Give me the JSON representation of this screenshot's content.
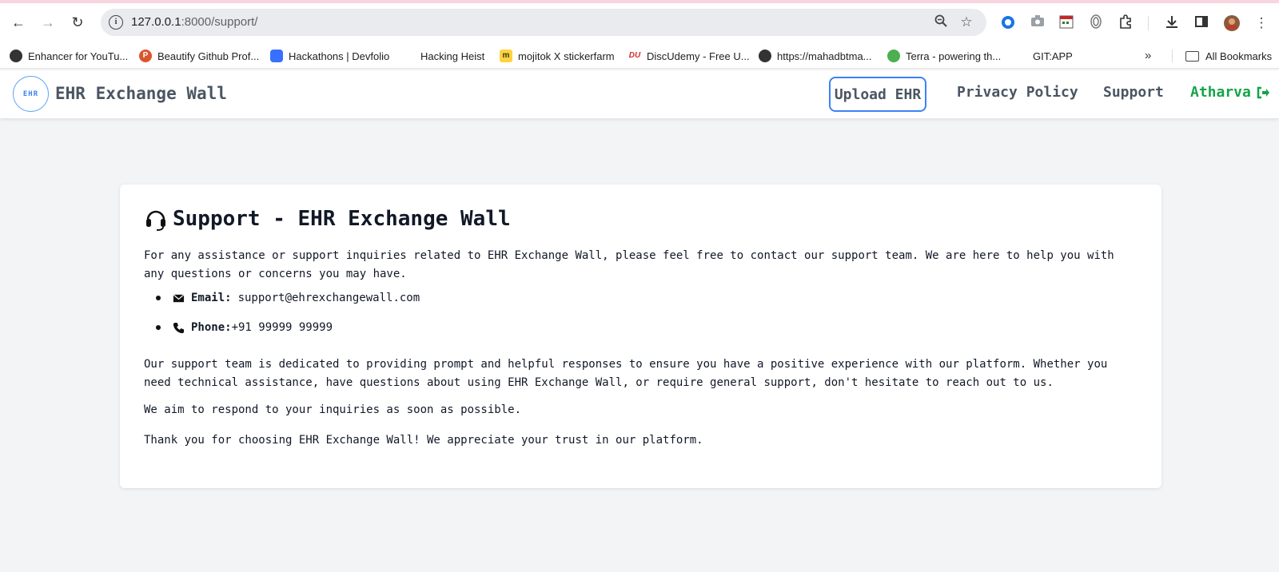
{
  "browser": {
    "url_host": "127.0.0.1",
    "url_path": ":8000/support/",
    "bookmarks": [
      {
        "label": "Enhancer for YouTu...",
        "icon": "globe-icon"
      },
      {
        "label": "Beautify Github Prof...",
        "icon": "product-hunt-icon"
      },
      {
        "label": "Hackathons | Devfolio",
        "icon": "devfolio-icon"
      },
      {
        "label": "Hacking Heist",
        "icon": "blank-icon"
      },
      {
        "label": "mojitok X stickerfarm",
        "icon": "mojitok-icon"
      },
      {
        "label": "DiscUdemy - Free U...",
        "icon": "discudemy-icon"
      },
      {
        "label": "https://mahadbtma...",
        "icon": "globe-icon"
      },
      {
        "label": "Terra - powering th...",
        "icon": "terra-icon"
      },
      {
        "label": "GIT:APP",
        "icon": "blank-icon"
      }
    ],
    "more_label": "»",
    "all_bookmarks": "All Bookmarks"
  },
  "header": {
    "logo_text": "EHR",
    "brand": "EHR Exchange Wall",
    "upload": "Upload EHR",
    "privacy": "Privacy Policy",
    "support": "Support",
    "user": "Atharva",
    "accent": "#3b82f6",
    "user_color": "#16a34a"
  },
  "support": {
    "title": "Support - EHR Exchange Wall",
    "intro": "For any assistance or support inquiries related to EHR Exchange Wall, please feel free to contact our support team. We are here to help you with any questions or concerns you may have.",
    "email_label": "Email:",
    "email_value": "support@ehrexchangewall.com",
    "phone_label": "Phone:",
    "phone_value": "+91 99999 99999",
    "para2": "Our support team is dedicated to providing prompt and helpful responses to ensure you have a positive experience with our platform. Whether you need technical assistance, have questions about using EHR Exchange Wall, or require general support, don't hesitate to reach out to us.",
    "para3": "We aim to respond to your inquiries as soon as possible.",
    "para4": "Thank you for choosing EHR Exchange Wall! We appreciate your trust in our platform."
  }
}
